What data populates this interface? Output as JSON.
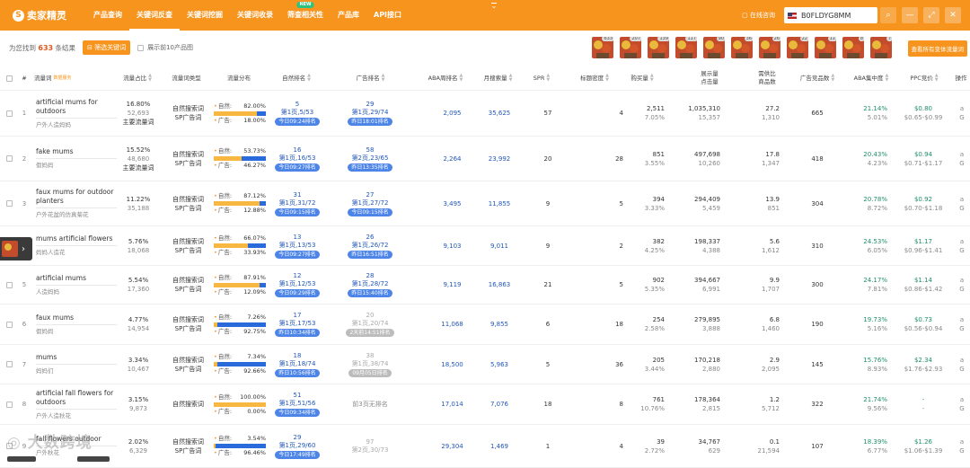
{
  "app": {
    "name": "卖家精灵",
    "logo_letter": "S"
  },
  "nav": {
    "items": [
      {
        "label": "产品查询"
      },
      {
        "label": "关键词反查",
        "active": true
      },
      {
        "label": "关键词挖掘"
      },
      {
        "label": "关键词收录"
      },
      {
        "label": "筛查相关性",
        "badge": "NEW"
      },
      {
        "label": "产品库"
      },
      {
        "label": "API接口"
      }
    ]
  },
  "topright": {
    "online_label": "在线咨询",
    "asin_value": "B0FLDYG8MM",
    "marketplace_flag": "us-flag-icon"
  },
  "subbar": {
    "found_prefix": "为您找到",
    "found_count": "633",
    "found_suffix": "条结果",
    "filter_button": "筛选关键词",
    "top10_label": "展示前10产品图",
    "view_all_button": "查看所有变体流量词",
    "thumb_counts": [
      "633",
      "207",
      "139",
      "117",
      "90",
      "36",
      "26",
      "22",
      "11",
      "8",
      "7"
    ]
  },
  "columns": {
    "idx": "#",
    "keyword": "流量词",
    "keyword_tag": "数据服务",
    "traffic_share": "流量占比",
    "kw_type": "流量词类型",
    "dist": "流量分布",
    "organic_rank": "自然排名",
    "ad_rank": "广告排名",
    "aba_rank": "ABA周排名",
    "monthly_search": "月搜索量",
    "spr": "SPR",
    "title_density": "标题密度",
    "purchases": "购买量",
    "impressions": "展示量\n点击量",
    "supply_demand": "需供比\n商品数",
    "ad_products": "广告竞品数",
    "aba_concentration": "ABA集中度",
    "ppc": "PPC竞价",
    "ops": "操作"
  },
  "rows": [
    {
      "num": "1",
      "kw": "artificial mums for outdoors",
      "cn": "户外人造妈妈",
      "share": "16.80%",
      "share_sub": "52,693",
      "share_tag": "主要流量词",
      "types": [
        "自然搜索词",
        "SP广告词"
      ],
      "org_label": "自然:",
      "org": "82.00%",
      "ad_label": "广告:",
      "ad": "18.00%",
      "ad_frac": 0.18,
      "rank_top": "5",
      "rank_mid": "第1页,5/53",
      "rank_pill": "今日09:24排名",
      "ad_top": "29",
      "ad_mid": "第1页,29/74",
      "ad_pill": "昨日18:01排名",
      "ad_grey": false,
      "aba": "2,095",
      "monthly": "35,625",
      "spr": "57",
      "density": "4",
      "buy": "2,511",
      "buy_pct": "7.05%",
      "imp": "1,035,310",
      "clk": "15,357",
      "sd": "27.2",
      "prod": "1,310",
      "adprod": "665",
      "conc": "21.14%",
      "conc_sub": "5.01%",
      "ppc": "$0.80",
      "ppc_range": "$0.65-$0.99"
    },
    {
      "num": "2",
      "kw": "fake mums",
      "cn": "假妈妈",
      "share": "15.52%",
      "share_sub": "48,680",
      "share_tag": "主要流量词",
      "types": [
        "自然搜索词",
        "SP广告词"
      ],
      "org_label": "自然:",
      "org": "53.73%",
      "ad_label": "广告:",
      "ad": "46.27%",
      "ad_frac": 0.4627,
      "rank_top": "16",
      "rank_mid": "第1页,16/53",
      "rank_pill": "今日09:27排名",
      "ad_top": "58",
      "ad_mid": "第2页,23/65",
      "ad_pill": "昨日13:35排名",
      "ad_grey": false,
      "aba": "2,264",
      "monthly": "23,992",
      "spr": "20",
      "density": "28",
      "buy": "851",
      "buy_pct": "3.55%",
      "imp": "497,698",
      "clk": "10,260",
      "sd": "17.8",
      "prod": "1,347",
      "adprod": "418",
      "conc": "20.43%",
      "conc_sub": "4.23%",
      "ppc": "$0.94",
      "ppc_range": "$0.71-$1.17"
    },
    {
      "num": "3",
      "kw": "faux mums for outdoor planters",
      "cn": "户外花盆的仿真菊花",
      "share": "11.22%",
      "share_sub": "35,188",
      "share_tag": "",
      "types": [
        "自然搜索词",
        "SP广告词"
      ],
      "org_label": "自然:",
      "org": "87.12%",
      "ad_label": "广告:",
      "ad": "12.88%",
      "ad_frac": 0.1288,
      "rank_top": "31",
      "rank_mid": "第1页,31/72",
      "rank_pill": "今日09:15排名",
      "ad_top": "27",
      "ad_mid": "第1页,27/72",
      "ad_pill": "今日09:15排名",
      "ad_grey": false,
      "aba": "3,495",
      "monthly": "11,855",
      "spr": "9",
      "density": "5",
      "buy": "394",
      "buy_pct": "3.33%",
      "imp": "294,409",
      "clk": "5,459",
      "sd": "13.9",
      "prod": "851",
      "adprod": "304",
      "conc": "20.78%",
      "conc_sub": "8.72%",
      "ppc": "$0.92",
      "ppc_range": "$0.70-$1.18"
    },
    {
      "num": "4",
      "kw": "mums artificial flowers",
      "cn": "妈妈人造花",
      "share": "5.76%",
      "share_sub": "18,068",
      "share_tag": "",
      "types": [
        "自然搜索词",
        "SP广告词"
      ],
      "org_label": "自然:",
      "org": "66.07%",
      "ad_label": "广告:",
      "ad": "33.93%",
      "ad_frac": 0.3393,
      "rank_top": "13",
      "rank_mid": "第1页,13/53",
      "rank_pill": "今日09:27排名",
      "ad_top": "26",
      "ad_mid": "第1页,26/72",
      "ad_pill": "昨日16:51排名",
      "ad_grey": false,
      "aba": "9,103",
      "monthly": "9,011",
      "spr": "9",
      "density": "2",
      "buy": "382",
      "buy_pct": "4.25%",
      "imp": "198,337",
      "clk": "4,388",
      "sd": "5.6",
      "prod": "1,612",
      "adprod": "310",
      "conc": "24.53%",
      "conc_sub": "6.05%",
      "ppc": "$1.17",
      "ppc_range": "$0.96-$1.41"
    },
    {
      "num": "5",
      "kw": "artificial mums",
      "cn": "人造妈妈",
      "share": "5.54%",
      "share_sub": "17,360",
      "share_tag": "",
      "types": [
        "自然搜索词",
        "SP广告词"
      ],
      "org_label": "自然:",
      "org": "87.91%",
      "ad_label": "广告:",
      "ad": "12.09%",
      "ad_frac": 0.1209,
      "rank_top": "12",
      "rank_mid": "第1页,12/53",
      "rank_pill": "今日09:29排名",
      "ad_top": "28",
      "ad_mid": "第1页,28/72",
      "ad_pill": "昨日15:40排名",
      "ad_grey": false,
      "aba": "9,119",
      "monthly": "16,863",
      "spr": "21",
      "density": "5",
      "buy": "902",
      "buy_pct": "5.35%",
      "imp": "394,667",
      "clk": "6,991",
      "sd": "9.9",
      "prod": "1,707",
      "adprod": "300",
      "conc": "24.17%",
      "conc_sub": "7.81%",
      "ppc": "$1.14",
      "ppc_range": "$0.86-$1.42"
    },
    {
      "num": "6",
      "kw": "faux mums",
      "cn": "假妈妈",
      "share": "4.77%",
      "share_sub": "14,954",
      "share_tag": "",
      "types": [
        "自然搜索词",
        "SP广告词"
      ],
      "org_label": "自然:",
      "org": "7.26%",
      "ad_label": "广告:",
      "ad": "92.75%",
      "ad_frac": 0.9275,
      "rank_top": "17",
      "rank_mid": "第1页,17/53",
      "rank_pill": "昨日10:34排名",
      "ad_top": "20",
      "ad_mid": "第1页,20/74",
      "ad_pill": "2天前14:51排名",
      "ad_grey": true,
      "aba": "11,068",
      "monthly": "9,855",
      "spr": "6",
      "density": "18",
      "buy": "254",
      "buy_pct": "2.58%",
      "imp": "279,895",
      "clk": "3,888",
      "sd": "6.8",
      "prod": "1,460",
      "adprod": "190",
      "conc": "19.73%",
      "conc_sub": "5.16%",
      "ppc": "$0.73",
      "ppc_range": "$0.56-$0.94"
    },
    {
      "num": "7",
      "kw": "mums",
      "cn": "妈妈们",
      "share": "3.34%",
      "share_sub": "10,467",
      "share_tag": "",
      "types": [
        "自然搜索词",
        "SP广告词"
      ],
      "org_label": "自然:",
      "org": "7.34%",
      "ad_label": "广告:",
      "ad": "92.66%",
      "ad_frac": 0.9266,
      "rank_top": "18",
      "rank_mid": "第1页,18/74",
      "rank_pill": "昨日10:56排名",
      "ad_top": "38",
      "ad_mid": "第1页,38/74",
      "ad_pill": "09月05日排名",
      "ad_grey": true,
      "aba": "18,500",
      "monthly": "5,963",
      "spr": "5",
      "density": "36",
      "buy": "205",
      "buy_pct": "3.44%",
      "imp": "170,218",
      "clk": "2,880",
      "sd": "2.9",
      "prod": "2,095",
      "adprod": "145",
      "conc": "15.76%",
      "conc_sub": "8.93%",
      "ppc": "$2.34",
      "ppc_range": "$1.76-$2.93"
    },
    {
      "num": "8",
      "kw": "artificial fall flowers for outdoors",
      "cn": "户外人造秋花",
      "share": "3.15%",
      "share_sub": "9,873",
      "share_tag": "",
      "types": [
        "自然搜索词"
      ],
      "org_label": "自然:",
      "org": "100.00%",
      "ad_label": "广告:",
      "ad": "0.00%",
      "ad_frac": 0,
      "rank_top": "51",
      "rank_mid": "第1页,51/56",
      "rank_pill": "今日09:34排名",
      "ad_top": "",
      "ad_mid": "前3页无排名",
      "ad_pill": "",
      "ad_grey": false,
      "aba": "17,014",
      "monthly": "7,076",
      "spr": "18",
      "density": "8",
      "buy": "761",
      "buy_pct": "10.76%",
      "imp": "178,364",
      "clk": "2,815",
      "sd": "1.2",
      "prod": "5,712",
      "adprod": "322",
      "conc": "21.74%",
      "conc_sub": "9.56%",
      "ppc": "-",
      "ppc_range": "-"
    },
    {
      "num": "9",
      "kw": "fall flowers outdoor",
      "cn": "户外秋花",
      "share": "2.02%",
      "share_sub": "6,329",
      "share_tag": "",
      "types": [
        "自然搜索词",
        "SP广告词"
      ],
      "org_label": "自然:",
      "org": "3.54%",
      "ad_label": "广告:",
      "ad": "96.46%",
      "ad_frac": 0.9646,
      "rank_top": "29",
      "rank_mid": "第1页,29/60",
      "rank_pill": "今日17:49排名",
      "ad_top": "97",
      "ad_mid": "第2页,30/73",
      "ad_pill": "",
      "ad_grey": true,
      "aba": "29,304",
      "monthly": "1,469",
      "spr": "1",
      "density": "4",
      "buy": "39",
      "buy_pct": "2.72%",
      "imp": "34,767",
      "clk": "629",
      "sd": "0.1",
      "prod": "21,594",
      "adprod": "107",
      "conc": "18.39%",
      "conc_sub": "6.77%",
      "ppc": "$1.26",
      "ppc_range": "$1.06-$1.39"
    }
  ],
  "watermark": "大数跨境",
  "colors": {
    "accent": "#f7941d",
    "blue": "#2156b8",
    "green": "#1f8f6a",
    "pill": "#4c84e8",
    "highlight": "#e2571d"
  }
}
